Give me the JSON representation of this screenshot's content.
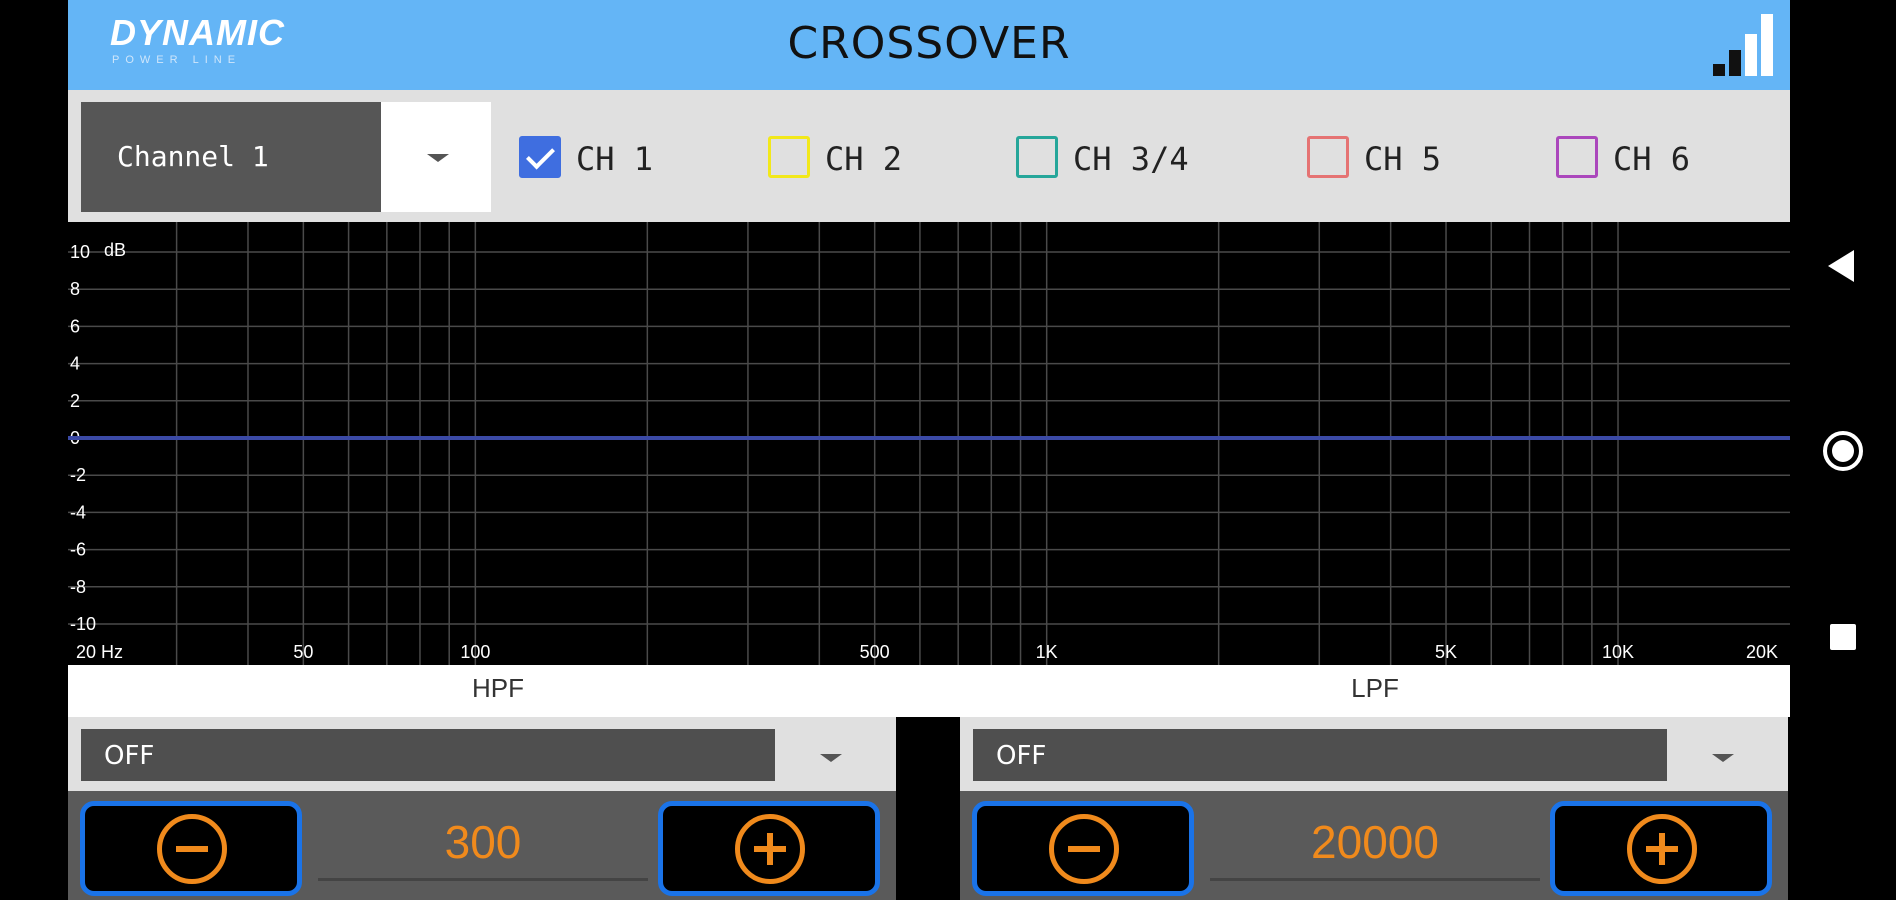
{
  "header": {
    "logo_main": "DYNAMIC",
    "logo_sub": "POWER LINE",
    "title": "CROSSOVER",
    "signal_icon": "signal-bars-icon"
  },
  "channel_bar": {
    "selected_channel": "Channel 1",
    "checkboxes": [
      {
        "label": "CH 1",
        "checked": true,
        "color": "#3f6ee0"
      },
      {
        "label": "CH 2",
        "checked": false,
        "color": "#f2e81a"
      },
      {
        "label": "CH 3/4",
        "checked": false,
        "color": "#26a69a"
      },
      {
        "label": "CH 5",
        "checked": false,
        "color": "#e57373"
      },
      {
        "label": "CH 6",
        "checked": false,
        "color": "#ab47bc"
      }
    ]
  },
  "graph": {
    "y_unit": "dB",
    "y_ticks": [
      "10",
      "8",
      "6",
      "4",
      "2",
      "0",
      "-2",
      "-4",
      "-6",
      "-8",
      "-10"
    ],
    "x_labels": [
      "20 Hz",
      "50",
      "100",
      "500",
      "1K",
      "5K",
      "10K",
      "20K"
    ],
    "response_db": 0,
    "line_color": "#3b4aa6"
  },
  "hpf": {
    "label": "HPF",
    "mode": "OFF",
    "value": "300"
  },
  "lpf": {
    "label": "LPF",
    "mode": "OFF",
    "value": "20000"
  },
  "colors": {
    "header_bg": "#64b5f6",
    "accent_orange": "#f08a1c",
    "button_border": "#1a73e8"
  }
}
